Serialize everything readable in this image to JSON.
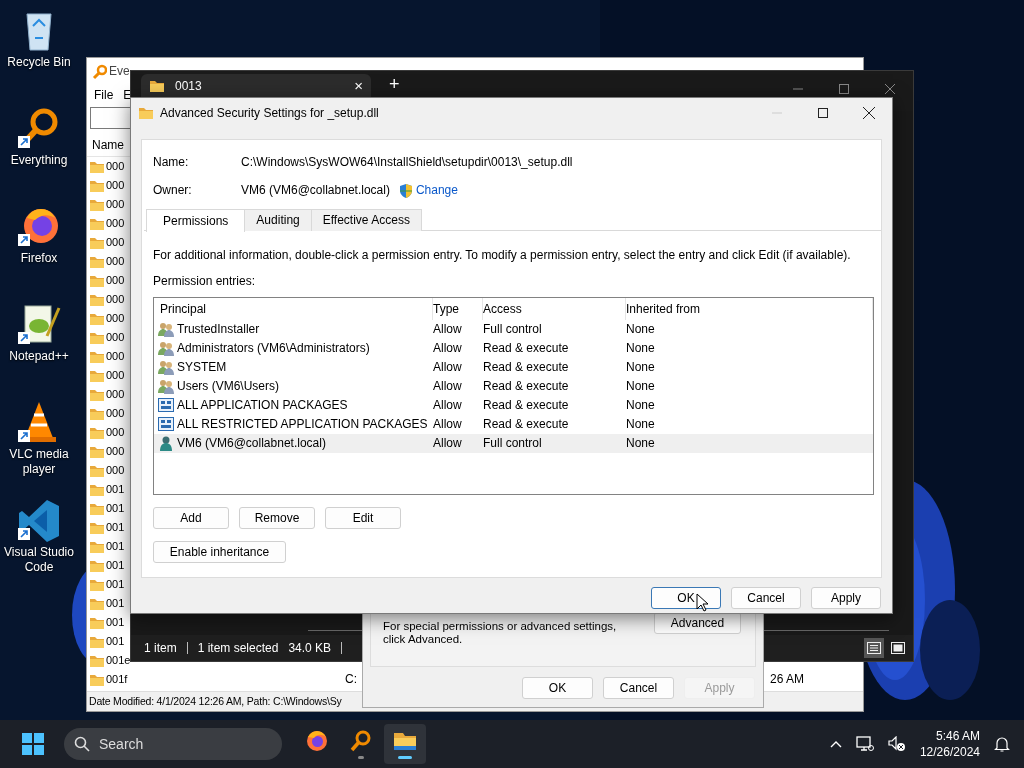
{
  "desktop_icons": [
    {
      "label": "Recycle Bin",
      "kind": "recycle"
    },
    {
      "label": "Everything",
      "kind": "everything"
    },
    {
      "label": "Firefox",
      "kind": "firefox"
    },
    {
      "label": "Notepad++",
      "kind": "notepad"
    },
    {
      "label": "VLC media player",
      "kind": "vlc"
    },
    {
      "label": "Visual Studio Code",
      "kind": "vscode"
    }
  ],
  "everything_window": {
    "title": "Eve",
    "menu": [
      "File",
      "E"
    ],
    "column": "Name",
    "rows": [
      {
        "name": "000"
      },
      {
        "name": "000"
      },
      {
        "name": "000"
      },
      {
        "name": "000"
      },
      {
        "name": "000"
      },
      {
        "name": "000"
      },
      {
        "name": "000"
      },
      {
        "name": "000"
      },
      {
        "name": "000"
      },
      {
        "name": "000"
      },
      {
        "name": "000"
      },
      {
        "name": "000"
      },
      {
        "name": "000"
      },
      {
        "name": "000"
      },
      {
        "name": "000"
      },
      {
        "name": "000"
      },
      {
        "name": "000"
      },
      {
        "name": "001"
      },
      {
        "name": "001"
      },
      {
        "name": "001"
      },
      {
        "name": "001"
      },
      {
        "name": "001"
      },
      {
        "name": "001"
      },
      {
        "name": "001"
      },
      {
        "name": "001"
      },
      {
        "name": "001"
      },
      {
        "name": "001e"
      },
      {
        "name": "001f",
        "path": "C:",
        "modified": "26 AM"
      }
    ],
    "status": "Date Modified: 4/1/2024 12:26 AM, Path: C:\\Windows\\Sy"
  },
  "explorer_window": {
    "tab": "0013",
    "tab_close": "×",
    "new_tab": "+",
    "status": [
      "1 item",
      "1 item selected",
      "34.0 KB"
    ],
    "views": [
      {
        "kind": "details",
        "selected": true
      },
      {
        "kind": "tiles",
        "selected": false
      }
    ]
  },
  "properties_dialog": {
    "text": "For special permissions or advanced settings, click Advanced.",
    "advanced_button": "Advanced",
    "buttons": [
      {
        "label": "OK",
        "disabled": false
      },
      {
        "label": "Cancel",
        "disabled": false
      },
      {
        "label": "Apply",
        "disabled": true
      }
    ]
  },
  "security_dialog": {
    "title": "Advanced Security Settings for _setup.dll",
    "name_label": "Name:",
    "name_value": "C:\\Windows\\SysWOW64\\InstallShield\\setupdir\\0013\\_setup.dll",
    "owner_label": "Owner:",
    "owner_value": "VM6 (VM6@collabnet.local)",
    "change_link": "Change",
    "tabs": [
      {
        "label": "Permissions",
        "selected": true
      },
      {
        "label": "Auditing",
        "selected": false
      },
      {
        "label": "Effective Access",
        "selected": false
      }
    ],
    "info": "For additional information, double-click a permission entry. To modify a permission entry, select the entry and click Edit (if available).",
    "entries_label": "Permission entries:",
    "table": {
      "columns": [
        "Principal",
        "Type",
        "Access",
        "Inherited from"
      ],
      "rows": [
        {
          "kind": "group",
          "principal": "TrustedInstaller",
          "type": "Allow",
          "access": "Full control",
          "inherited_from": "None",
          "selected": false
        },
        {
          "kind": "group",
          "principal": "Administrators (VM6\\Administrators)",
          "type": "Allow",
          "access": "Read & execute",
          "inherited_from": "None",
          "selected": false
        },
        {
          "kind": "group",
          "principal": "SYSTEM",
          "type": "Allow",
          "access": "Read & execute",
          "inherited_from": "None",
          "selected": false
        },
        {
          "kind": "group",
          "principal": "Users (VM6\\Users)",
          "type": "Allow",
          "access": "Read & execute",
          "inherited_from": "None",
          "selected": false
        },
        {
          "kind": "package",
          "principal": "ALL APPLICATION PACKAGES",
          "type": "Allow",
          "access": "Read & execute",
          "inherited_from": "None",
          "selected": false
        },
        {
          "kind": "package",
          "principal": "ALL RESTRICTED APPLICATION PACKAGES",
          "type": "Allow",
          "access": "Read & execute",
          "inherited_from": "None",
          "selected": false
        },
        {
          "kind": "user",
          "principal": "VM6 (VM6@collabnet.local)",
          "type": "Allow",
          "access": "Full control",
          "inherited_from": "None",
          "selected": true
        }
      ]
    },
    "entry_buttons": [
      "Add",
      "Remove",
      "Edit"
    ],
    "inheritance_button": "Enable inheritance",
    "footer_buttons": [
      {
        "label": "OK",
        "focused": true
      },
      {
        "label": "Cancel",
        "focused": false
      },
      {
        "label": "Apply",
        "focused": false
      }
    ]
  },
  "taskbar": {
    "search_placeholder": "Search",
    "apps": [
      {
        "kind": "firefox",
        "running": false,
        "active": false
      },
      {
        "kind": "everything",
        "running": true,
        "active": false
      },
      {
        "kind": "explorer",
        "running": true,
        "active": true
      }
    ],
    "time": "5:46 AM",
    "date": "12/26/2024"
  }
}
